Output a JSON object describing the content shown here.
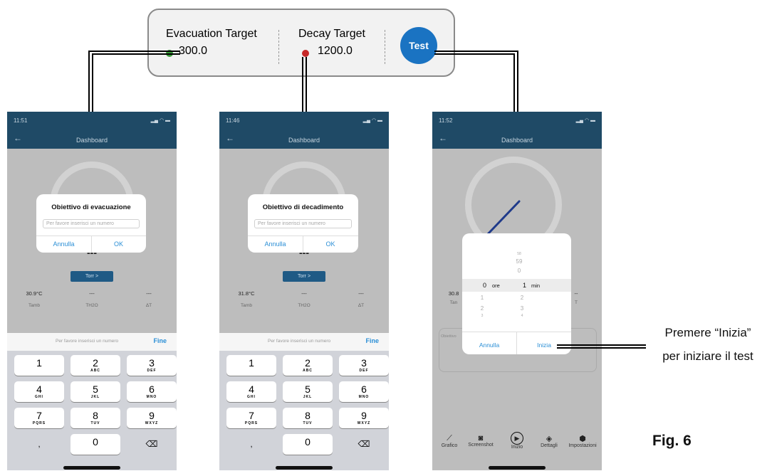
{
  "callout": {
    "evac_label": "Evacuation Target",
    "evac_value": "300.0",
    "decay_label": "Decay Target",
    "decay_value": "1200.0",
    "test_button": "Test",
    "colors": {
      "evac_dot": "#3a9a3a",
      "decay_dot": "#c62828",
      "test_button": "#1a73c2"
    }
  },
  "phones": [
    {
      "time": "11:51",
      "title": "Dashboard",
      "dialog": {
        "title": "Obiettivo di evacuazione",
        "placeholder": "Per favore inserisci un numero",
        "cancel": "Annulla",
        "ok": "OK"
      },
      "reading": "---",
      "torr_button": "Torr >",
      "stats": [
        {
          "value": "30.9°C",
          "label": "Tamb"
        },
        {
          "value": "---",
          "label": "TH2O"
        },
        {
          "value": "---",
          "label": "ΔT"
        }
      ],
      "keyboard_placeholder": "Per favore inserisci un numero",
      "keyboard_done": "Fine"
    },
    {
      "time": "11:46",
      "title": "Dashboard",
      "dialog": {
        "title": "Obiettivo di decadimento",
        "placeholder": "Per favore inserisci un numero",
        "cancel": "Annulla",
        "ok": "OK"
      },
      "reading": "---",
      "torr_button": "Torr >",
      "stats": [
        {
          "value": "31.8°C",
          "label": "Tamb"
        },
        {
          "value": "---",
          "label": "TH2O"
        },
        {
          "value": "---",
          "label": "ΔT"
        }
      ],
      "keyboard_placeholder": "Per favore inserisci un numero",
      "keyboard_done": "Fine"
    }
  ],
  "keypad": {
    "keys": [
      {
        "digit": "1",
        "letters": ""
      },
      {
        "digit": "2",
        "letters": "ABC"
      },
      {
        "digit": "3",
        "letters": "DEF"
      },
      {
        "digit": "4",
        "letters": "GHI"
      },
      {
        "digit": "5",
        "letters": "JKL"
      },
      {
        "digit": "6",
        "letters": "MNO"
      },
      {
        "digit": "7",
        "letters": "PQRS"
      },
      {
        "digit": "8",
        "letters": "TUV"
      },
      {
        "digit": "9",
        "letters": "WXYZ"
      },
      {
        "digit": ",",
        "letters": ""
      },
      {
        "digit": "0",
        "letters": ""
      },
      {
        "digit": "⌫",
        "letters": ""
      }
    ]
  },
  "phone3": {
    "time": "11:52",
    "title": "Dashboard",
    "picker": {
      "hours_above": [
        "",
        "",
        ""
      ],
      "hours_selected": "0",
      "hours_unit": "ore",
      "hours_below": [
        "1",
        "2",
        "3"
      ],
      "minutes_above": [
        "58",
        "59",
        "0"
      ],
      "minutes_selected": "1",
      "minutes_unit": "min",
      "minutes_below": [
        "2",
        "3",
        "4"
      ],
      "cancel": "Annulla",
      "start": "Inizia"
    },
    "stat_partial": "30.8",
    "stat_label_partial": "Tan",
    "obj_partial": "Obiettivo",
    "nav": [
      {
        "label": "Grafico",
        "icon": "chart-icon"
      },
      {
        "label": "Screenshot",
        "icon": "camera-icon"
      },
      {
        "label": "Inizio",
        "icon": "play-icon"
      },
      {
        "label": "Dettagli",
        "icon": "layers-icon"
      },
      {
        "label": "Impostazioni",
        "icon": "settings-icon"
      }
    ]
  },
  "annotation": {
    "line1": "Premere “Inizia”",
    "line2": "per iniziare il test"
  },
  "figure_label": "Fig. 6"
}
